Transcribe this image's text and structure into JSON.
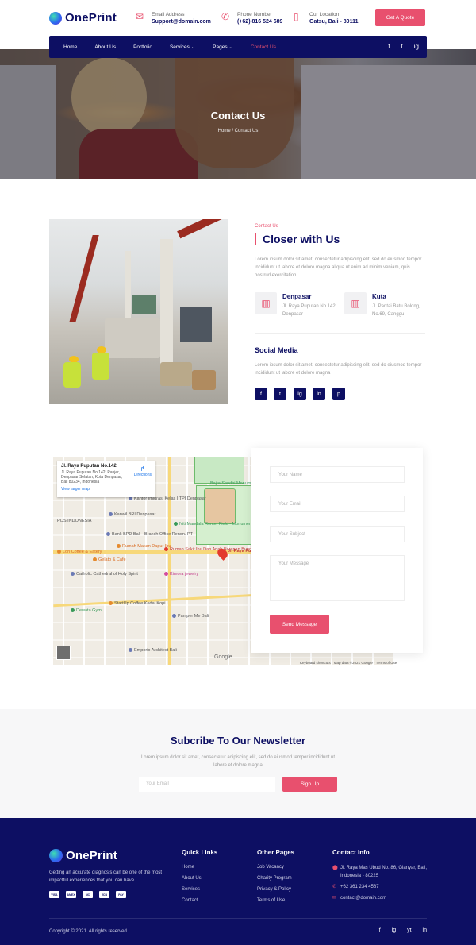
{
  "brand": {
    "name": "OnePrint",
    "accent": "#e8506e",
    "navy": "#0d0f63"
  },
  "header": {
    "email": {
      "label": "Email Address",
      "value": "Support@domain.com",
      "icon": "envelope-icon"
    },
    "phone": {
      "label": "Phone Number",
      "value": "(+62) 816 524 689",
      "icon": "phone-icon"
    },
    "location": {
      "label": "Our Location",
      "value": "Gatsu, Bali - 80111",
      "icon": "map-icon"
    },
    "quote_button": "Get A Quote"
  },
  "nav": {
    "items": [
      "Home",
      "About Us",
      "Portfolio",
      "Services ⌄",
      "Pages ⌄",
      "Contact Us"
    ],
    "social": [
      "f",
      "t",
      "ig"
    ]
  },
  "hero": {
    "title": "Contact Us",
    "breadcrumb": "Home / Contact Us"
  },
  "about": {
    "eyebrow": "Contact Us",
    "title": "Closer with Us",
    "text": "Lorem ipsum dolor sit amet, consectetur adipiscing elit, sed do eiusmod tempor incididunt ut labore et dolore magna aliqua ut enim ad minim veniam, quis nostrud exercitation",
    "locations": [
      {
        "name": "Denpasar",
        "address": "Jl. Raya Puputan No 142, Denpasar"
      },
      {
        "name": "Kuta",
        "address": "Jl. Pantai Batu Bolong, No.69, Canggu"
      }
    ],
    "social_title": "Social Media",
    "social_text": "Lorem ipsum dolor sit amet, consectetur adipiscing elit, sed do eiusmod tempor incididunt ut labore et dolore magna",
    "social_icons": [
      "f",
      "t",
      "ig",
      "in",
      "p"
    ]
  },
  "map": {
    "card_title": "Jl. Raya Puputan No.142",
    "card_address": "Jl. Raya Puputan No.142, Panjer, Denpasar Selatan, Kota Denpasar, Bali 80234, Indonesia",
    "directions": "Directions",
    "larger": "View larger map",
    "labels": [
      "Kantor Imigrasi Kelas I TPI Denpasar",
      "POS INDONESIA",
      "Kanwil BRI Denpasar",
      "Bank BPD Bali - Branch Office Renon. PT",
      "Rumah Makan Dapur Ibu",
      "Lon Coffee & Eatery",
      "Gelato & Cafe",
      "Rumah Sakit Ibu Dan Anak Harapan Bunda",
      "Catholic Cathedral of Holy Spirit",
      "Kimora jewelry",
      "Dewata Gym",
      "StartUp Coffee Kedai Kopi",
      "Pamper Me Bali",
      "Emporio Architect Bali",
      "Niti Mandala Renon Field - Monument to...",
      "Bajra Sandhi Monument",
      "Jl. Raya Puputan No. 142, Panjer"
    ],
    "credit": "Keyboard shortcuts · Map data ©2021 Google · Terms of Use",
    "google": "Google"
  },
  "form": {
    "name_placeholder": "Your Name",
    "email_placeholder": "Your Email",
    "subject_placeholder": "Your Subject",
    "message_placeholder": "Your Message",
    "submit": "Send Message"
  },
  "newsletter": {
    "title": "Subcribe To Our Newsletter",
    "text": "Lorem ipsum dolor sit amet, consectetur adipiscing elit, sed do eiusmod tempor incididunt ut labore et dolore magna",
    "placeholder": "Your Email",
    "button": "Sign Up"
  },
  "footer": {
    "description": "Getting an accurate diagnosis can be one of the most impactful experiences that you can have.",
    "payments": [
      "VISA",
      "AMEX",
      "MC",
      "JCB",
      "PAY"
    ],
    "quick_links_title": "Quick Links",
    "quick_links": [
      "Home",
      "About Us",
      "Services",
      "Contact"
    ],
    "other_pages_title": "Other Pages",
    "other_pages": [
      "Job Vacancy",
      "Charity Program",
      "Privacy & Policy",
      "Terms of Use"
    ],
    "contact_title": "Contact Info",
    "contact": [
      {
        "icon": "map-pin-icon",
        "text": "Jl. Raya Mas Ubud No. 86, Gianyar, Bali, Indonesia - 80225"
      },
      {
        "icon": "phone-icon",
        "text": "+62 361 234 4567"
      },
      {
        "icon": "envelope-icon",
        "text": "contact@domain.com"
      }
    ],
    "copyright": "Copyright © 2021. All rights reserved.",
    "social": [
      "f",
      "ig",
      "yt",
      "in"
    ]
  }
}
